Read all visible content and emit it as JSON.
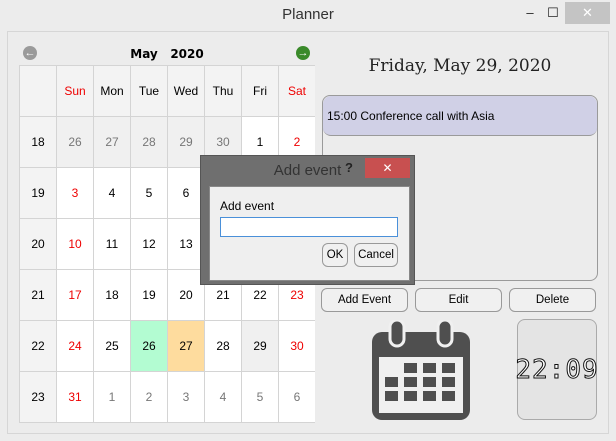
{
  "window": {
    "title": "Planner",
    "minimize": "‒",
    "maximize": "☐",
    "close": "✕"
  },
  "calendar": {
    "month": "May",
    "year": "2020",
    "prev": "previous-month",
    "next": "next-month",
    "headers": [
      "Sun",
      "Mon",
      "Tue",
      "Wed",
      "Thu",
      "Fri",
      "Sat"
    ],
    "weeks": [
      {
        "week": "18",
        "days": [
          "26",
          "27",
          "28",
          "29",
          "30",
          "1",
          "2"
        ]
      },
      {
        "week": "19",
        "days": [
          "3",
          "4",
          "5",
          "6",
          "7",
          "8",
          "9"
        ]
      },
      {
        "week": "20",
        "days": [
          "10",
          "11",
          "12",
          "13",
          "14",
          "15",
          "16"
        ]
      },
      {
        "week": "21",
        "days": [
          "17",
          "18",
          "19",
          "20",
          "21",
          "22",
          "23"
        ]
      },
      {
        "week": "22",
        "days": [
          "24",
          "25",
          "26",
          "27",
          "28",
          "29",
          "30"
        ]
      },
      {
        "week": "23",
        "days": [
          "31",
          "1",
          "2",
          "3",
          "4",
          "5",
          "6"
        ]
      }
    ],
    "colors": {
      "today": "#b3fcd2",
      "highlight": "#fedc9e",
      "selected": "#f0f0f0"
    }
  },
  "date_heading": "Friday, May 29, 2020",
  "events": [
    "15:00 Conference call with Asia"
  ],
  "buttons": {
    "add": "Add Event",
    "edit": "Edit",
    "delete": "Delete"
  },
  "clock": "22:09",
  "dialog": {
    "title": "Add event",
    "help": "?",
    "close": "✕",
    "label": "Add event",
    "value": "",
    "ok": "OK",
    "cancel": "Cancel"
  }
}
